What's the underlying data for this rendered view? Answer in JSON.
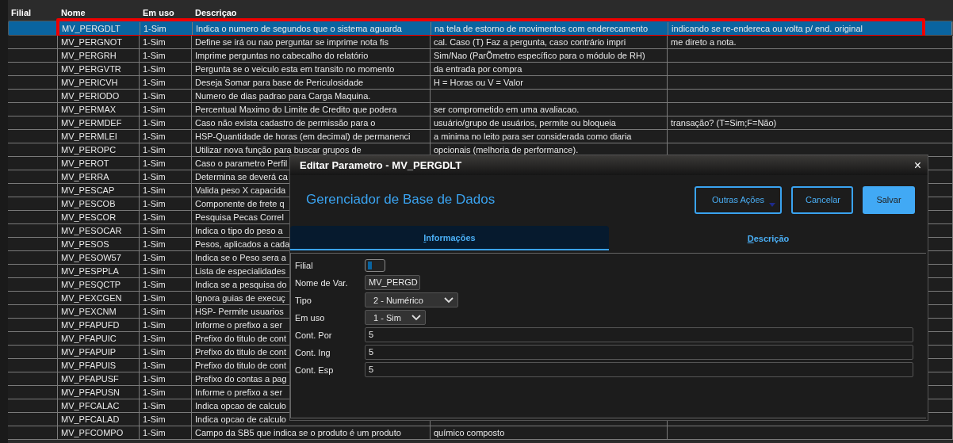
{
  "table": {
    "columns": [
      "Filial",
      "Nome",
      "Em uso",
      "Descriçao"
    ],
    "rows": [
      {
        "name": "MV_PERGDLT",
        "in_use": "1-Sim",
        "desc": "Indica o numero de segundos que o sistema aguarda",
        "desc_2": "na tela de estorno de movimentos com enderecamento",
        "desc_3": "indicando se re-endereca ou volta p/ end. original",
        "selected": true,
        "highlighted": true
      },
      {
        "name": "MV_PERGNOT",
        "in_use": "1-Sim",
        "desc": "Define se irá ou nao perguntar se imprime nota fis",
        "desc_2": "cal. Caso (T) Faz a pergunta, caso contrário impri",
        "desc_3": "me direto a nota.",
        "selected": false,
        "highlighted": false
      },
      {
        "name": "MV_PERGRH",
        "in_use": "1-Sim",
        "desc": "Imprime perguntas no cabecalho do relatório",
        "desc_2": "Sim/Nao (ParÕmetro específico para o módulo de RH)",
        "selected": false,
        "highlighted": false
      },
      {
        "name": "MV_PERGVTR",
        "in_use": "1-Sim",
        "desc": "Pergunta se o veiculo esta em transito no momento",
        "desc_2": "da entrada por compra",
        "selected": false,
        "highlighted": false
      },
      {
        "name": "MV_PERICVH",
        "in_use": "1-Sim",
        "desc": "Deseja Somar para base de Periculosidade",
        "desc_2": "H = Horas ou V = Valor",
        "selected": false,
        "highlighted": false
      },
      {
        "name": "MV_PERIODO",
        "in_use": "1-Sim",
        "desc": "Numero de dias padrao para Carga Maquina.",
        "selected": false,
        "highlighted": false
      },
      {
        "name": "MV_PERMAX",
        "in_use": "1-Sim",
        "desc": "Percentual Maximo do Limite de Credito que podera",
        "desc_2": "ser comprometido em uma avaliacao.",
        "selected": false,
        "highlighted": false
      },
      {
        "name": "MV_PERMDEF",
        "in_use": "1-Sim",
        "desc": "Caso não exista cadastro de permissão para o",
        "desc_2": "usuário/grupo de usuários, permite ou bloqueia",
        "desc_3": "transação? (T=Sim;F=Não)",
        "selected": false,
        "highlighted": false
      },
      {
        "name": "MV_PERMLEI",
        "in_use": "1-Sim",
        "desc": "HSP-Quantidade de horas (em decimal) de permanenci",
        "desc_2": "a minima no leito para ser considerada como diaria",
        "selected": false,
        "highlighted": false
      },
      {
        "name": "MV_PEROPC",
        "in_use": "1-Sim",
        "desc": "Utilizar nova função para buscar grupos de",
        "desc_2": "opcionais (melhoria de performance).",
        "selected": false,
        "highlighted": false
      },
      {
        "name": "MV_PEROT",
        "in_use": "1-Sim",
        "desc": "Caso o parametro Perfil",
        "selected": false,
        "highlighted": false
      },
      {
        "name": "MV_PERRA",
        "in_use": "1-Sim",
        "desc": "Determina se deverá ca",
        "selected": false,
        "highlighted": false
      },
      {
        "name": "MV_PESCAP",
        "in_use": "1-Sim",
        "desc": "Valida peso X capacida",
        "selected": false,
        "highlighted": false
      },
      {
        "name": "MV_PESCOB",
        "in_use": "1-Sim",
        "desc": "Componente de frete q",
        "selected": false,
        "highlighted": false
      },
      {
        "name": "MV_PESCOR",
        "in_use": "1-Sim",
        "desc": "Pesquisa Pecas Correl",
        "selected": false,
        "highlighted": false
      },
      {
        "name": "MV_PESOCAR",
        "in_use": "1-Sim",
        "desc": "Indica o tipo do peso a",
        "selected": false,
        "highlighted": false
      },
      {
        "name": "MV_PESOS",
        "in_use": "1-Sim",
        "desc": "Pesos, aplicados a cada",
        "selected": false,
        "highlighted": false
      },
      {
        "name": "MV_PESOW57",
        "in_use": "1-Sim",
        "desc": "Indica se o Peso sera a",
        "selected": false,
        "highlighted": false
      },
      {
        "name": "MV_PESPPLA",
        "in_use": "1-Sim",
        "desc": "Lista de especialidades",
        "selected": false,
        "highlighted": false
      },
      {
        "name": "MV_PESQCTP",
        "in_use": "1-Sim",
        "desc": "Indica se a pesquisa do",
        "selected": false,
        "highlighted": false
      },
      {
        "name": "MV_PEXCGEN",
        "in_use": "1-Sim",
        "desc": "Ignora guias de execuç",
        "selected": false,
        "highlighted": false
      },
      {
        "name": "MV_PEXCNM",
        "in_use": "1-Sim",
        "desc": "HSP- Permite usuarios",
        "selected": false,
        "highlighted": false
      },
      {
        "name": "MV_PFAPUFD",
        "in_use": "1-Sim",
        "desc": "Informe o prefixo a ser",
        "selected": false,
        "highlighted": false
      },
      {
        "name": "MV_PFAPUIC",
        "in_use": "1-Sim",
        "desc": "Prefixo do titulo de cont",
        "selected": false,
        "highlighted": false
      },
      {
        "name": "MV_PFAPUIP",
        "in_use": "1-Sim",
        "desc": "Prefixo do titulo de cont",
        "selected": false,
        "highlighted": false
      },
      {
        "name": "MV_PFAPUIS",
        "in_use": "1-Sim",
        "desc": "Prefixo do titulo de cont",
        "selected": false,
        "highlighted": false
      },
      {
        "name": "MV_PFAPUSF",
        "in_use": "1-Sim",
        "desc": "Prefixo do contas a pag",
        "selected": false,
        "highlighted": false
      },
      {
        "name": "MV_PFAPUSN",
        "in_use": "1-Sim",
        "desc": "Informe o prefixo a ser",
        "selected": false,
        "highlighted": false
      },
      {
        "name": "MV_PFCALAC",
        "in_use": "1-Sim",
        "desc": "Indica opcao de calculo",
        "selected": false,
        "highlighted": false
      },
      {
        "name": "MV_PFCALAD",
        "in_use": "1-Sim",
        "desc": "Indica opcao de calculo",
        "selected": false,
        "highlighted": false
      },
      {
        "name": "MV_PFCOMPO",
        "in_use": "1-Sim",
        "desc": "Campo da SB5 que indica se o produto é um produto",
        "desc_2": "químico composto",
        "selected": false,
        "highlighted": false
      }
    ]
  },
  "dialog": {
    "title": "Editar Parametro - MV_PERGDLT",
    "close": "×",
    "heading": "Gerenciador de Base de Dados",
    "buttons": [
      {
        "label": "Outras Ações",
        "kind": "menu"
      },
      {
        "label": "Cancelar",
        "kind": "outline"
      },
      {
        "label": "Salvar",
        "kind": "primary"
      }
    ],
    "tabs": [
      {
        "label": "Informações",
        "selected": true
      },
      {
        "label": "Descrição",
        "selected": false
      }
    ],
    "fields": [
      {
        "label": "Filial",
        "kind": "toggle"
      },
      {
        "label": "Nome de Var.",
        "kind": "short",
        "value": "MV_PERGD"
      },
      {
        "label": "Tipo",
        "kind": "select",
        "value": "2 - Numérico"
      },
      {
        "label": "Em uso",
        "kind": "select-small",
        "value": "1 - Sim"
      },
      {
        "label": "Cont. Por",
        "kind": "text",
        "value": "5"
      },
      {
        "label": "Cont. Ing",
        "kind": "text",
        "value": "5"
      },
      {
        "label": "Cont. Esp",
        "kind": "text",
        "value": "5"
      }
    ]
  }
}
